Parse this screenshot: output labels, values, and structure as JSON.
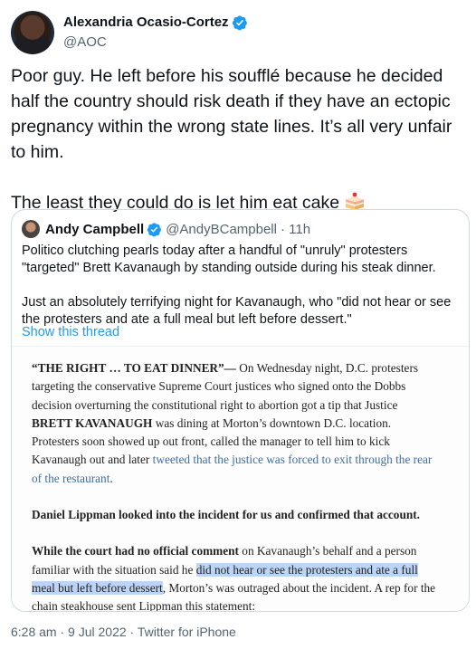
{
  "tweet": {
    "author": {
      "display_name": "Alexandria Ocasio-Cortez",
      "handle": "@AOC"
    },
    "paragraph1": "Poor guy. He left before his soufflé because he decided half the country should risk death if they have an ectopic pregnancy within the wrong state lines. It’s all very unfair to him.",
    "paragraph2": "The least they could do is let him eat cake",
    "emoji": "cake-slice-icon"
  },
  "quote": {
    "author": {
      "display_name": "Andy Campbell",
      "handle": "@AndyBCampbell",
      "time": "· 11h"
    },
    "paragraph1": "Politico clutching pearls today after a handful of \"unruly\" protesters \"targeted\" Brett Kavanaugh by standing outside during his steak dinner.",
    "paragraph2": "Just an absolutely terrifying night for Kavanaugh, who \"did not hear or see the protesters and ate a full meal but left before dessert.\"",
    "show_thread": "Show this thread"
  },
  "article": {
    "p1_bold": "“THE RIGHT … TO EAT DINNER”—",
    "p1_text1": " On Wednesday night, D.C. protesters targeting the conservative Supreme Court justices who signed onto the Dobbs decision overturning the constitutional right to abortion got a tip that Justice ",
    "p1_bold2": "BRETT KAVANAUGH",
    "p1_text2": " was dining at Morton’s downtown D.C. location. Protesters soon showed up out front, called the manager to tell him to kick Kavanaugh out and later ",
    "p1_link": "tweeted that the justice was forced to exit through the rear of the restaurant",
    "p1_end": ".",
    "p2": "Daniel Lippman looked into the incident for us and confirmed that account.",
    "p3_bold": "While the court had no official comment",
    "p3_text1": " on Kavanaugh’s behalf and a person familiar with the situation said he ",
    "p3_highlight": "did not hear or see the protesters and ate a full meal but left before dessert",
    "p3_text2": ", Morton’s was outraged about the incident. A rep for the chain steakhouse sent Lippman this statement:"
  },
  "footer": {
    "time": "6:28 am",
    "sep1": " · ",
    "date": "9 Jul 2022",
    "sep2": " · ",
    "source": "Twitter for iPhone"
  },
  "colors": {
    "link": "#1d9bf0",
    "verified": "#1d9bf0",
    "highlight": "#bcd5f7"
  }
}
